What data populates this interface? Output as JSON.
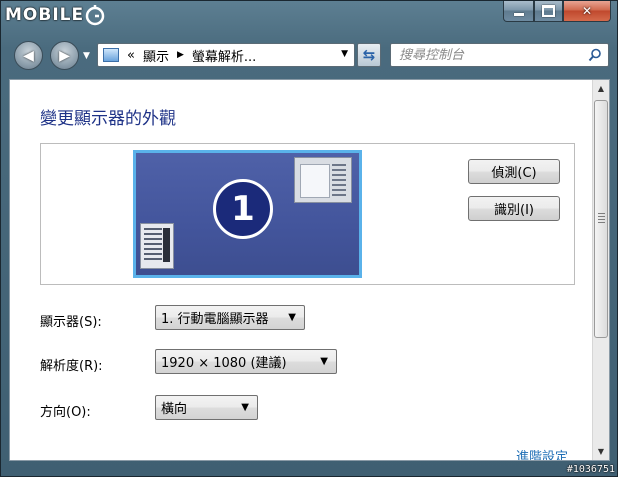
{
  "watermark": {
    "logo_text": "MOBILE",
    "id_text": "#1036751"
  },
  "navigation": {
    "breadcrumb_prefix": "«",
    "breadcrumb": [
      "顯示",
      "螢幕解析..."
    ],
    "search_placeholder": "搜尋控制台"
  },
  "page": {
    "title": "變更顯示器的外觀",
    "monitor_number": "1",
    "detect_button": "偵測(C)",
    "identify_button": "識別(I)",
    "display_label": "顯示器(S):",
    "display_value": "1. 行動電腦顯示器",
    "resolution_label": "解析度(R):",
    "resolution_value": "1920 × 1080 (建議)",
    "orientation_label": "方向(O):",
    "orientation_value": "橫向",
    "advanced_link": "進階設定"
  },
  "icons": {
    "back": "back-arrow-icon",
    "forward": "forward-arrow-icon",
    "refresh": "refresh-icon",
    "search": "search-icon",
    "control_panel": "control-panel-icon"
  },
  "colors": {
    "title_blue": "#1e3287",
    "link_blue": "#1f6fb6",
    "monitor_background": "#4f61a8",
    "monitor_border": "#5ab2ea"
  }
}
